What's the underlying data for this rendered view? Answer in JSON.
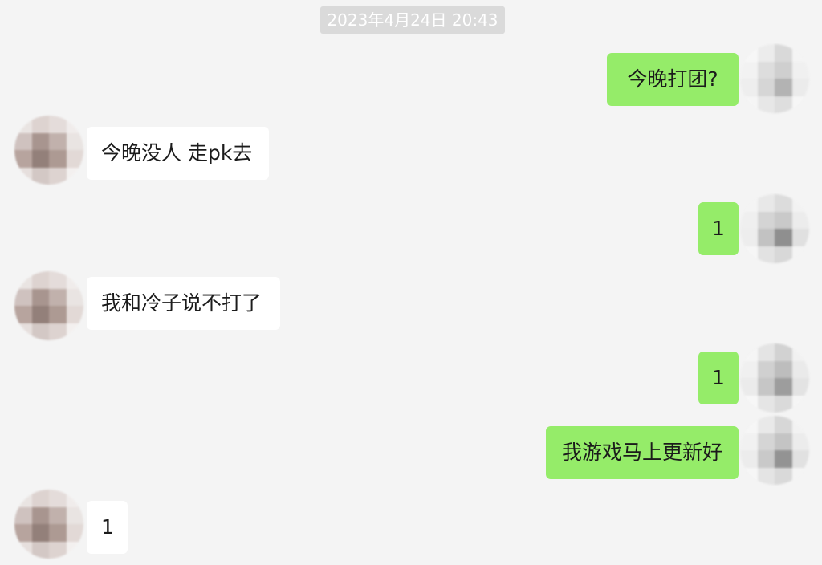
{
  "chat": {
    "timestamp": "2023年4月24日 20:43",
    "messages": [
      {
        "side": "outgoing",
        "text": "今晚打团?"
      },
      {
        "side": "incoming",
        "text": "今晚没人 走pk去"
      },
      {
        "side": "outgoing",
        "text": "1"
      },
      {
        "side": "incoming",
        "text": "我和冷子说不打了"
      },
      {
        "side": "outgoing",
        "text": "1"
      },
      {
        "side": "outgoing",
        "text": "我游戏马上更新好"
      },
      {
        "side": "incoming",
        "text": "1"
      }
    ]
  },
  "colors": {
    "outgoing_bubble": "#95ec69",
    "incoming_bubble": "#ffffff",
    "background": "#f4f4f4",
    "timestamp_pill": "#dadada"
  }
}
